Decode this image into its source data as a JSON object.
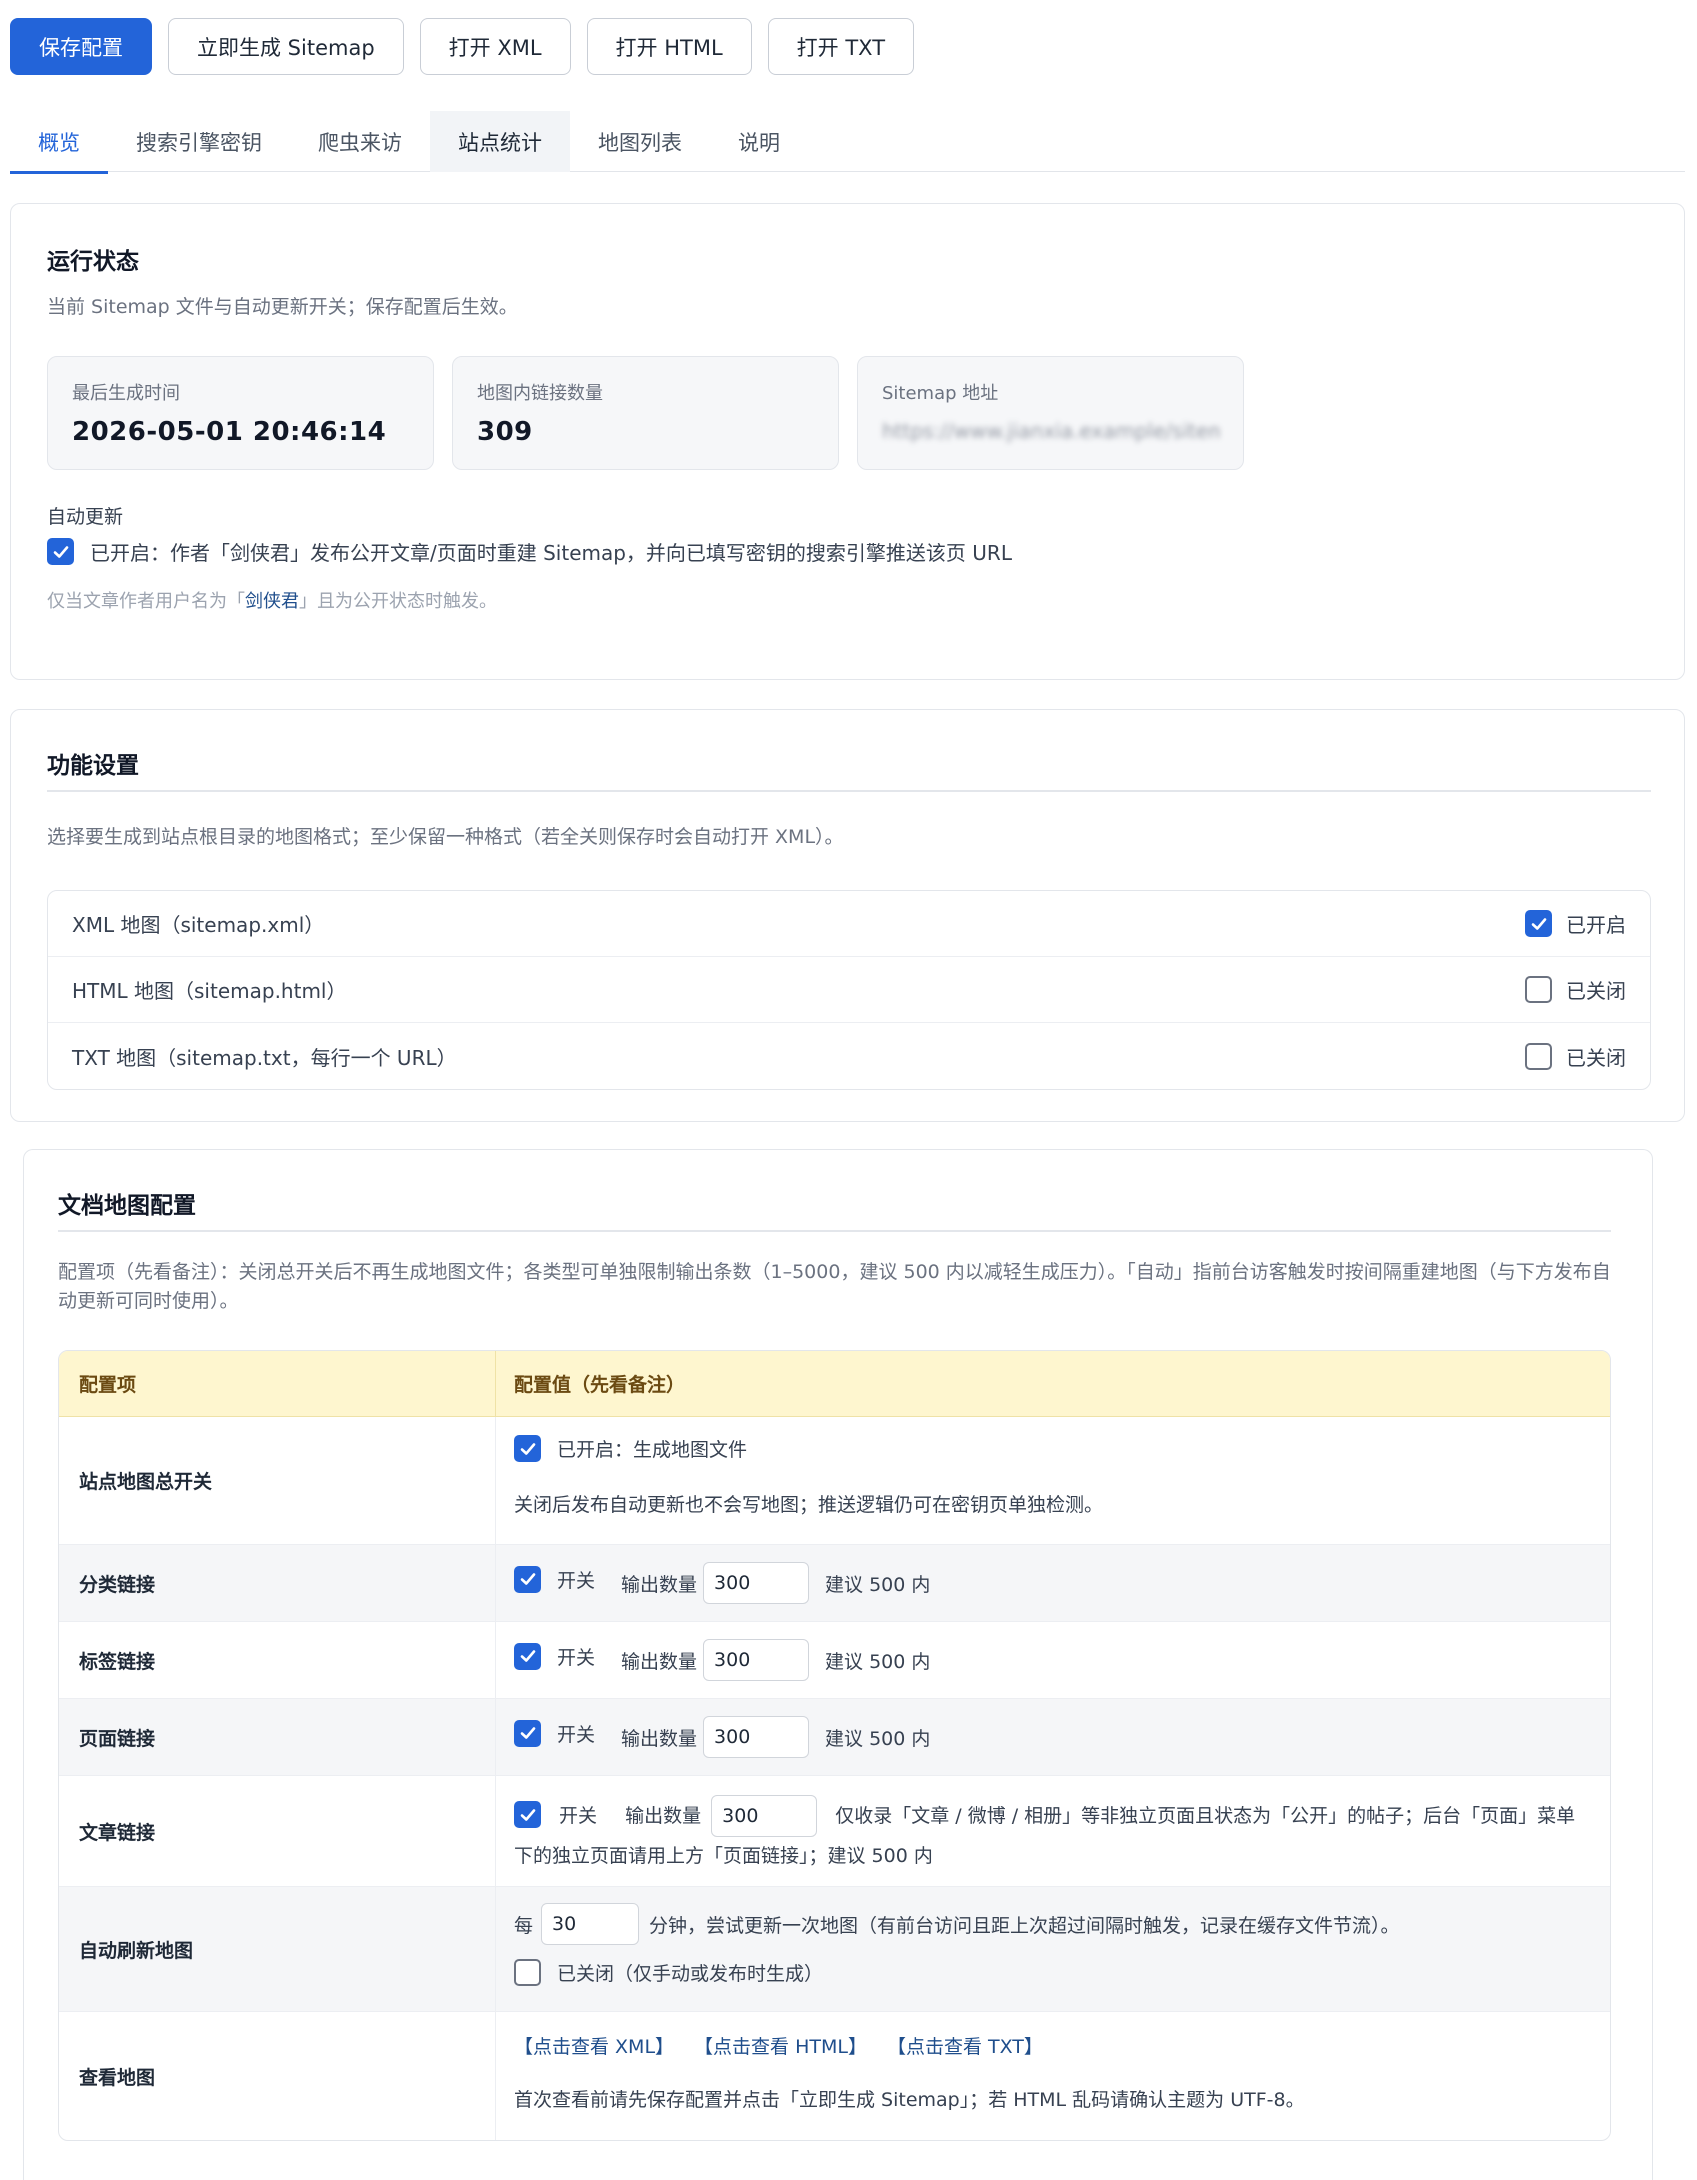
{
  "toolbar": {
    "save": "保存配置",
    "generate": "立即生成 Sitemap",
    "open_xml": "打开 XML",
    "open_html": "打开 HTML",
    "open_txt": "打开 TXT"
  },
  "tabs": [
    "概览",
    "搜索引擎密钥",
    "爬虫来访",
    "站点统计",
    "地图列表",
    "说明"
  ],
  "status": {
    "title": "运行状态",
    "subtitle": "当前 Sitemap 文件与自动更新开关；保存配置后生效。",
    "last_generated_label": "最后生成时间",
    "last_generated_value": "2026-05-01 20:46:14",
    "link_count_label": "地图内链接数量",
    "link_count_value": "309",
    "sitemap_url_label": "Sitemap 地址",
    "sitemap_url_value": "https://www.jianxia.example/sitemap.xml",
    "auto_update_label": "自动更新",
    "auto_update_text": "已开启：作者「剑侠君」发布公开文章/页面时重建 Sitemap，并向已填写密钥的搜索引擎推送该页 URL",
    "note_prefix": "仅当文章作者用户名为「",
    "note_author": "剑侠君",
    "note_suffix": "」且为公开状态时触发。"
  },
  "features": {
    "title": "功能设置",
    "desc": "选择要生成到站点根目录的地图格式；至少保留一种格式（若全关则保存时会自动打开 XML）。",
    "rows": [
      {
        "label": "XML 地图（sitemap.xml）",
        "state": "已开启",
        "checked": true
      },
      {
        "label": "HTML 地图（sitemap.html）",
        "state": "已关闭",
        "checked": false
      },
      {
        "label": "TXT 地图（sitemap.txt，每行一个 URL）",
        "state": "已关闭",
        "checked": false
      }
    ]
  },
  "docmap": {
    "title": "文档地图配置",
    "desc": "配置项（先看备注）：关闭总开关后不再生成地图文件；各类型可单独限制输出条数（1–5000，建议 500 内以减轻生成压力）。「自动」指前台访客触发时按间隔重建地图（与下方发布自动更新可同时使用）。",
    "head_item": "配置项",
    "head_value": "配置值（先看备注）",
    "master_label": "站点地图总开关",
    "master_check": "已开启：生成地图文件",
    "master_note": "关闭后发布自动更新也不会写地图；推送逻辑仍可在密钥页单独检测。",
    "switch_text": "开关",
    "count_text": "输出数量",
    "suggest": "建议 500 内",
    "category_label": "分类链接",
    "category_count": "300",
    "tag_label": "标签链接",
    "tag_count": "300",
    "page_label": "页面链接",
    "page_count": "300",
    "post_label": "文章链接",
    "post_count": "300",
    "post_note": "仅收录「文章 / 微博 / 相册」等非独立页面且状态为「公开」的帖子；后台「页面」菜单下的独立页面请用上方「页面链接」；建议 500 内",
    "auto_label": "自动刷新地图",
    "auto_prefix": "每",
    "auto_minutes": "30",
    "auto_suffix": "分钟，尝试更新一次地图（有前台访问且距上次超过间隔时触发，记录在缓存文件节流）。",
    "auto_check": "已关闭（仅手动或发布时生成）",
    "view_label": "查看地图",
    "view_xml": "【点击查看 XML】",
    "view_html": "【点击查看 HTML】",
    "view_txt": "【点击查看 TXT】",
    "view_note": "首次查看前请先保存配置并点击「立即生成 Sitemap」；若 HTML 乱码请确认主题为 UTF-8。"
  },
  "colors": {
    "accent": "#2364d9",
    "table_header_bg": "#fef6cf"
  }
}
